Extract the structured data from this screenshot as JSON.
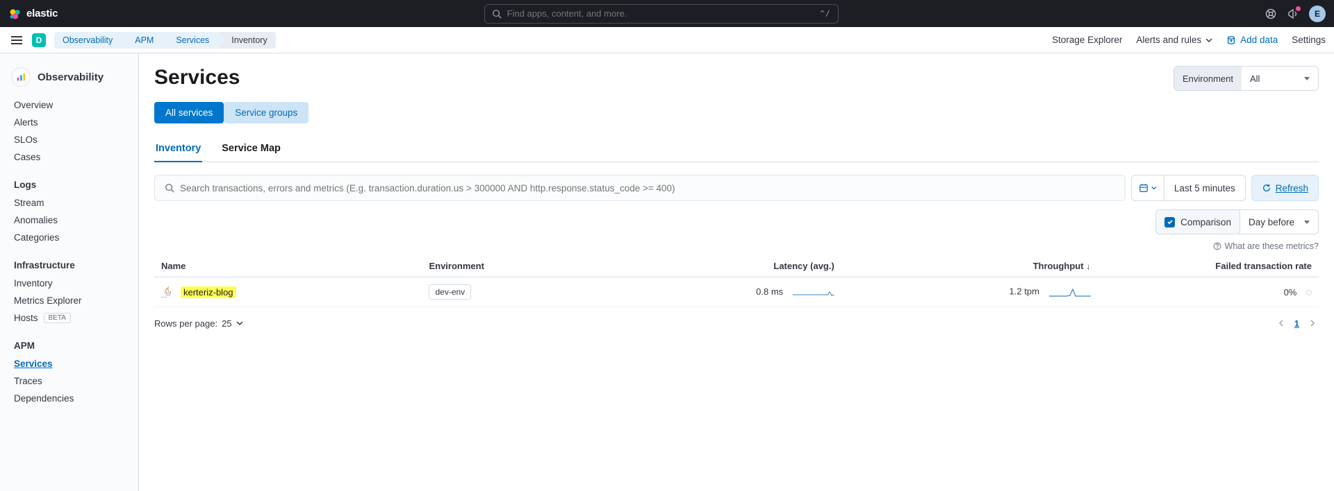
{
  "top": {
    "brand": "elastic",
    "search_placeholder": "Find apps, content, and more.",
    "kbd_hint": "^/",
    "avatar_initial": "E"
  },
  "sub": {
    "space_initial": "D",
    "crumbs": [
      "Observability",
      "APM",
      "Services",
      "Inventory"
    ],
    "right": {
      "storage": "Storage Explorer",
      "alerts": "Alerts and rules",
      "add_data": "Add data",
      "settings": "Settings"
    }
  },
  "sidebar": {
    "section": "Observability",
    "groups": [
      {
        "label": null,
        "items": [
          {
            "label": "Overview",
            "active": false
          },
          {
            "label": "Alerts",
            "active": false
          },
          {
            "label": "SLOs",
            "active": false
          },
          {
            "label": "Cases",
            "active": false
          }
        ]
      },
      {
        "label": "Logs",
        "items": [
          {
            "label": "Stream",
            "active": false
          },
          {
            "label": "Anomalies",
            "active": false
          },
          {
            "label": "Categories",
            "active": false
          }
        ]
      },
      {
        "label": "Infrastructure",
        "items": [
          {
            "label": "Inventory",
            "active": false
          },
          {
            "label": "Metrics Explorer",
            "active": false
          },
          {
            "label": "Hosts",
            "active": false,
            "badge": "BETA"
          }
        ]
      },
      {
        "label": "APM",
        "items": [
          {
            "label": "Services",
            "active": true
          },
          {
            "label": "Traces",
            "active": false
          },
          {
            "label": "Dependencies",
            "active": false
          }
        ]
      }
    ]
  },
  "page": {
    "title": "Services",
    "env_label": "Environment",
    "env_value": "All",
    "view_tabs": {
      "all": "All services",
      "groups": "Service groups"
    },
    "sub_tabs": {
      "inventory": "Inventory",
      "map": "Service Map"
    },
    "filter_placeholder": "Search transactions, errors and metrics (E.g. transaction.duration.us > 300000 AND http.response.status_code >= 400)",
    "time_range": "Last 5 minutes",
    "refresh": "Refresh",
    "comparison_label": "Comparison",
    "comparison_value": "Day before",
    "metrics_hint": "What are these metrics?"
  },
  "table": {
    "columns": {
      "name": "Name",
      "env": "Environment",
      "latency": "Latency (avg.)",
      "throughput": "Throughput",
      "failed": "Failed transaction rate"
    },
    "rows": [
      {
        "name": "kerteriz-blog",
        "env": "dev-env",
        "latency": "0.8 ms",
        "throughput": "1.2 tpm",
        "failed": "0%"
      }
    ],
    "rows_per_page_label": "Rows per page:",
    "rows_per_page_value": "25",
    "page_current": "1"
  }
}
